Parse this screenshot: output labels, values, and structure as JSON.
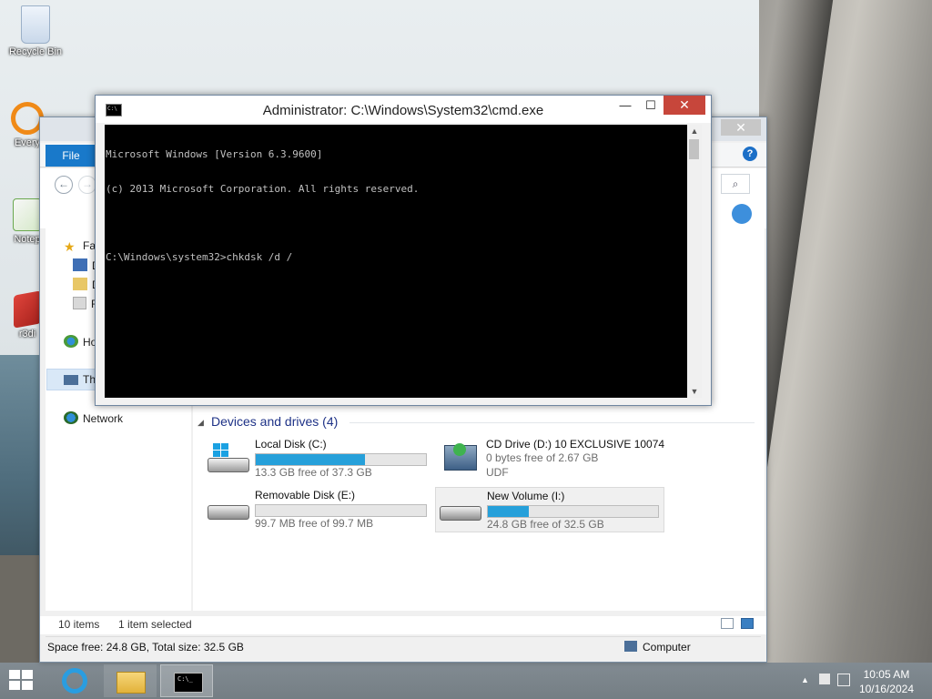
{
  "desktop": {
    "icons": [
      {
        "label": "Recycle Bin",
        "icon": "recycle-bin-icon"
      },
      {
        "label": "Every",
        "icon": "search-everything-icon"
      },
      {
        "label": "Notep",
        "icon": "notepad-plus-icon"
      },
      {
        "label": "r3di",
        "icon": "app-shortcut-icon"
      }
    ]
  },
  "explorer": {
    "ribbon": {
      "file_tab": "File",
      "help": "?"
    },
    "nav": {
      "back": "←",
      "forward": "→",
      "search_icon": "⌕",
      "items": [
        {
          "label": "Fa",
          "icon": "star-icon"
        },
        {
          "label": "D",
          "icon": "desktop-folder-icon"
        },
        {
          "label": "D",
          "icon": "downloads-folder-icon"
        },
        {
          "label": "R",
          "icon": "recent-places-icon"
        },
        {
          "label": "Ho",
          "icon": "homegroup-icon"
        },
        {
          "label": "Th",
          "icon": "this-pc-icon"
        },
        {
          "label": "Network",
          "icon": "network-icon"
        }
      ]
    },
    "group": {
      "header": "Devices and drives (4)",
      "arrow": "◢"
    },
    "drives": [
      {
        "name": "Local Disk (C:)",
        "free": "13.3 GB free of 37.3 GB",
        "fill_pct": 64,
        "icon": "windows-drive-icon",
        "bar": true
      },
      {
        "name": "CD Drive (D:) 10 EXCLUSIVE 10074",
        "free": "0 bytes free of 2.67 GB",
        "extra": "UDF",
        "icon": "cd-drive-icon",
        "bar": false
      },
      {
        "name": "Removable Disk (E:)",
        "free": "99.7 MB free of 99.7 MB",
        "fill_pct": 0,
        "icon": "removable-drive-icon",
        "bar": true
      },
      {
        "name": "New Volume (I:)",
        "free": "24.8 GB free of 32.5 GB",
        "fill_pct": 24,
        "icon": "hard-drive-icon",
        "bar": true,
        "selected": true
      }
    ],
    "status": {
      "items": "10 items",
      "selected": "1 item selected"
    },
    "details": {
      "space": "Space free: 24.8 GB, Total size: 32.5 GB",
      "location": "Computer"
    }
  },
  "cmd": {
    "title": "Administrator: C:\\Windows\\System32\\cmd.exe",
    "buttons": {
      "minimize": "—",
      "maximize": "☐",
      "close": "✕"
    },
    "lines": [
      "Microsoft Windows [Version 6.3.9600]",
      "(c) 2013 Microsoft Corporation. All rights reserved.",
      "",
      "C:\\Windows\\system32>chkdsk /d /"
    ]
  },
  "taskbar": {
    "buttons": [
      {
        "name": "internet-explorer",
        "active": false
      },
      {
        "name": "file-explorer",
        "active": false
      },
      {
        "name": "command-prompt",
        "active": true
      }
    ],
    "clock": {
      "time": "10:05 AM",
      "date": "10/16/2024"
    }
  },
  "colors": {
    "accent": "#1979ca",
    "drive_bar": "#26a0da",
    "close_red": "#c7463b",
    "group_header": "#1e3287"
  }
}
